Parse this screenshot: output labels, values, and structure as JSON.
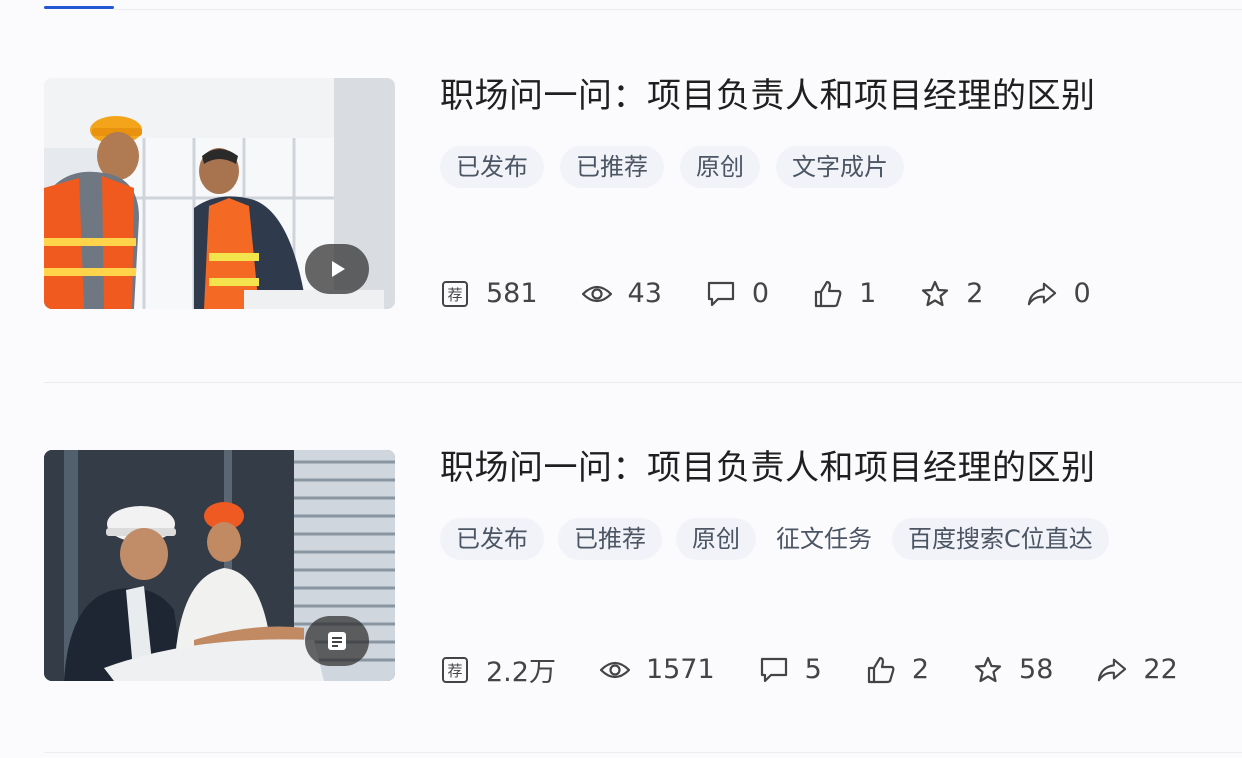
{
  "articles": [
    {
      "title": "职场问一问：项目负责人和项目经理的区别",
      "media_type": "video",
      "tags": [
        "已发布",
        "已推荐",
        "原创",
        "文字成片"
      ],
      "stats": {
        "recommend": "581",
        "views": "43",
        "comments": "0",
        "likes": "1",
        "favorites": "2",
        "shares": "0"
      }
    },
    {
      "title": "职场问一问：项目负责人和项目经理的区别",
      "media_type": "article",
      "tags": [
        "已发布",
        "已推荐",
        "原创",
        "征文任务",
        "百度搜索C位直达"
      ],
      "stats": {
        "recommend": "2.2万",
        "views": "1571",
        "comments": "5",
        "likes": "2",
        "favorites": "58",
        "shares": "22"
      }
    }
  ],
  "icons": {
    "recommend": "recommend-badge-icon",
    "views": "eye-icon",
    "comments": "comment-icon",
    "likes": "thumbs-up-icon",
    "favorites": "star-icon",
    "shares": "share-icon",
    "recommend_glyph": "荐"
  },
  "colors": {
    "accent": "#2456d8",
    "tag_bg": "#f1f3f8",
    "divider": "#e9ebf0"
  }
}
